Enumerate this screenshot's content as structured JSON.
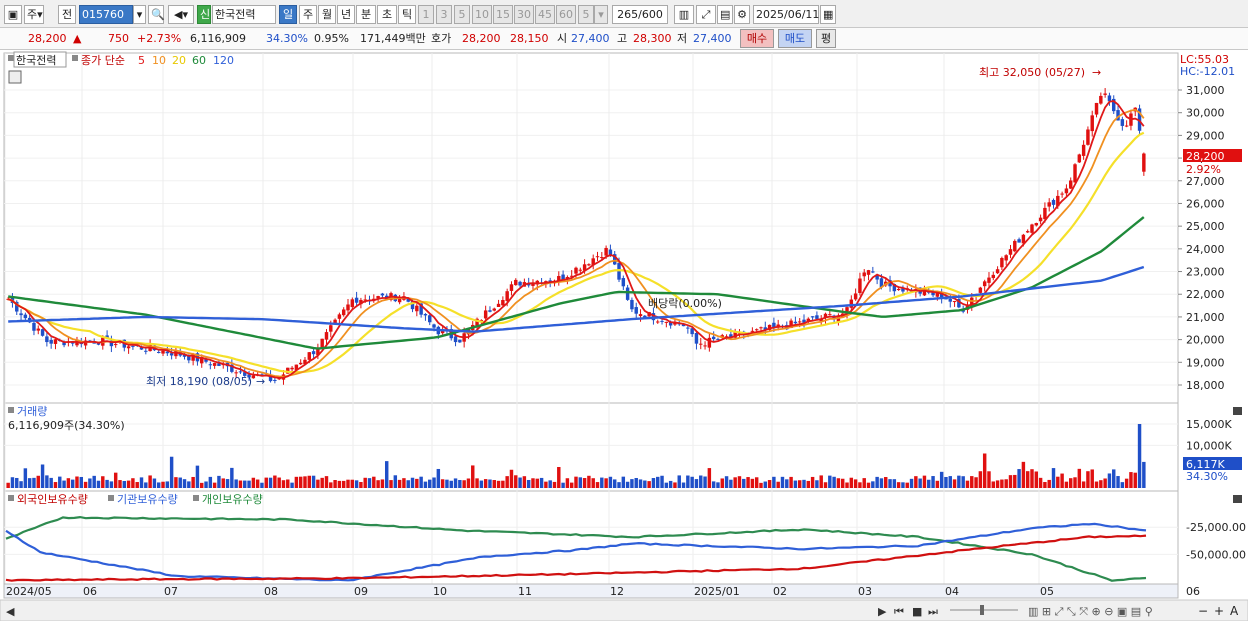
{
  "toolbar": {
    "period_char": "주",
    "all_char": "전",
    "code": "015760",
    "new_badge": "신",
    "stock_name": "한국전력",
    "tf_day": "일",
    "tf_week": "주",
    "tf_month": "월",
    "tf_year": "년",
    "tf_min": "분",
    "tf_sec": "초",
    "tf_tick": "틱",
    "intervals": [
      "1",
      "3",
      "5",
      "10",
      "15",
      "30",
      "45",
      "60"
    ],
    "interval_value": "5",
    "count": "265",
    "count_max": "/600",
    "date": "2025/06/11"
  },
  "quote": {
    "price": "28,200",
    "arrow": "▲",
    "change": "750",
    "change_pct": "+2.73%",
    "volume": "6,116,909",
    "vol_ratio": "34.30%",
    "turnover": "0.95%",
    "amount": "171,449백만",
    "hoga_label": "호가",
    "ask": "28,200",
    "bid": "28,150",
    "open_label": "시",
    "open": "27,400",
    "high_label": "고",
    "high": "28,300",
    "low_label": "저",
    "low": "27,400",
    "buy_btn": "매수",
    "sell_btn": "매도",
    "eval_btn": "평"
  },
  "legend": {
    "stock": "한국전력",
    "close_label": "종가 단순",
    "ma5": "5",
    "ma10": "10",
    "ma20": "20",
    "ma60": "60",
    "ma120": "120",
    "lc": "LC:55.03",
    "hc": "HC:-12.01",
    "annot_high": "최고 32,050 (05/27)",
    "annot_low": "최저 18,190 (08/05)",
    "annot_div": "배당락(0.00%)",
    "price_tag": "28,200",
    "pct_tag": "2.92%",
    "vol_title": "거래량",
    "vol_value": "6,116,909주(34.30%)",
    "vol_tag": "6,117K",
    "vol_pct_tag": "34.30%",
    "hold_foreign": "외국인보유수량",
    "hold_inst": "기관보유수량",
    "hold_indiv": "개인보유수량"
  },
  "colors": {
    "up": "#e01010",
    "down": "#1f4fc8",
    "ma5": "#e01818",
    "ma10": "#f09020",
    "ma20": "#f5e02a",
    "ma60": "#1f8a3a",
    "ma120": "#2f5fd8"
  },
  "chart_data": {
    "type": "candlestick",
    "price_ticks": [
      "31,000",
      "30,000",
      "29,000",
      "28,000",
      "27,000",
      "26,000",
      "25,000",
      "24,000",
      "23,000",
      "22,000",
      "21,000",
      "20,000",
      "19,000",
      "18,000"
    ],
    "ylim": [
      17500,
      32500
    ],
    "volume_ticks": [
      "15,000K",
      "10,000K"
    ],
    "holding_ticks": [
      "-25,000.00",
      "-50,000.00"
    ],
    "x_labels": [
      "2024/05",
      "06",
      "07",
      "08",
      "09",
      "10",
      "11",
      "12",
      "2025/01",
      "02",
      "03",
      "04",
      "05",
      "06"
    ],
    "close_anchors": [
      {
        "date": "2024/05/02",
        "close": 21800
      },
      {
        "date": "2024/05/16",
        "close": 19900
      },
      {
        "date": "2024/06/03",
        "close": 19950
      },
      {
        "date": "2024/07/01",
        "close": 19400
      },
      {
        "date": "2024/08/05",
        "close": 18190
      },
      {
        "date": "2024/08/20",
        "close": 19600
      },
      {
        "date": "2024/09/02",
        "close": 21800
      },
      {
        "date": "2024/09/20",
        "close": 21900
      },
      {
        "date": "2024/10/02",
        "close": 20400
      },
      {
        "date": "2024/10/10",
        "close": 20000
      },
      {
        "date": "2024/10/30",
        "close": 22500
      },
      {
        "date": "2024/11/15",
        "close": 22700
      },
      {
        "date": "2024/12/02",
        "close": 24000
      },
      {
        "date": "2024/12/10",
        "close": 21300
      },
      {
        "date": "2024/12/30",
        "close": 20600
      },
      {
        "date": "2025/01/02",
        "close": 19800
      },
      {
        "date": "2025/02/03",
        "close": 20600
      },
      {
        "date": "2025/02/25",
        "close": 21200
      },
      {
        "date": "2025/03/04",
        "close": 23300
      },
      {
        "date": "2025/03/10",
        "close": 22400
      },
      {
        "date": "2025/04/01",
        "close": 21900
      },
      {
        "date": "2025/04/07",
        "close": 21300
      },
      {
        "date": "2025/04/22",
        "close": 23600
      },
      {
        "date": "2025/05/02",
        "close": 25100
      },
      {
        "date": "2025/05/15",
        "close": 26800
      },
      {
        "date": "2025/05/27",
        "close": 30900
      },
      {
        "date": "2025/06/04",
        "close": 29400
      },
      {
        "date": "2025/06/09",
        "close": 30400
      },
      {
        "date": "2025/06/10",
        "close": 27450
      },
      {
        "date": "2025/06/11",
        "close": 28200
      }
    ],
    "ma60_anchors": [
      {
        "date": "2024/05/02",
        "value": 21900
      },
      {
        "date": "2024/06/20",
        "value": 21100
      },
      {
        "date": "2024/08/20",
        "value": 19600
      },
      {
        "date": "2024/10/02",
        "value": 20100
      },
      {
        "date": "2024/11/15",
        "value": 21600
      },
      {
        "date": "2024/12/05",
        "value": 22100
      },
      {
        "date": "2025/01/10",
        "value": 22000
      },
      {
        "date": "2025/02/25",
        "value": 21200
      },
      {
        "date": "2025/03/10",
        "value": 21000
      },
      {
        "date": "2025/04/07",
        "value": 21300
      },
      {
        "date": "2025/05/02",
        "value": 22300
      },
      {
        "date": "2025/05/27",
        "value": 23900
      },
      {
        "date": "2025/06/11",
        "value": 25400
      }
    ],
    "ma120_anchors": [
      {
        "date": "2024/05/02",
        "value": 20800
      },
      {
        "date": "2024/06/20",
        "value": 21000
      },
      {
        "date": "2024/08/01",
        "value": 20900
      },
      {
        "date": "2024/09/20",
        "value": 20500
      },
      {
        "date": "2024/10/15",
        "value": 20350
      },
      {
        "date": "2024/12/10",
        "value": 20900
      },
      {
        "date": "2025/02/25",
        "value": 21500
      },
      {
        "date": "2025/04/07",
        "value": 21900
      },
      {
        "date": "2025/05/27",
        "value": 22600
      },
      {
        "date": "2025/06/11",
        "value": 23200
      }
    ],
    "holdings": {
      "foreign": [
        [
          0,
          -74000
        ],
        [
          0.1,
          -73000
        ],
        [
          0.3,
          -72000
        ],
        [
          0.5,
          -68000
        ],
        [
          0.7,
          -63000
        ],
        [
          0.85,
          -45000
        ],
        [
          0.95,
          -34000
        ],
        [
          1,
          -33000
        ]
      ],
      "institution": [
        [
          0,
          -28000
        ],
        [
          0.03,
          -48000
        ],
        [
          0.15,
          -70000
        ],
        [
          0.3,
          -74000
        ],
        [
          0.42,
          -52000
        ],
        [
          0.5,
          -46000
        ],
        [
          0.55,
          -40000
        ],
        [
          0.7,
          -45000
        ],
        [
          0.8,
          -42000
        ],
        [
          0.9,
          -26000
        ],
        [
          0.95,
          -22000
        ],
        [
          0.97,
          -24000
        ],
        [
          1,
          -28000
        ]
      ],
      "individual": [
        [
          0,
          -36000
        ],
        [
          0.05,
          -16000
        ],
        [
          0.25,
          -18000
        ],
        [
          0.4,
          -28000
        ],
        [
          0.55,
          -34000
        ],
        [
          0.7,
          -27000
        ],
        [
          0.8,
          -34000
        ],
        [
          0.9,
          -50000
        ],
        [
          0.97,
          -74000
        ],
        [
          1,
          -72000
        ]
      ]
    }
  }
}
